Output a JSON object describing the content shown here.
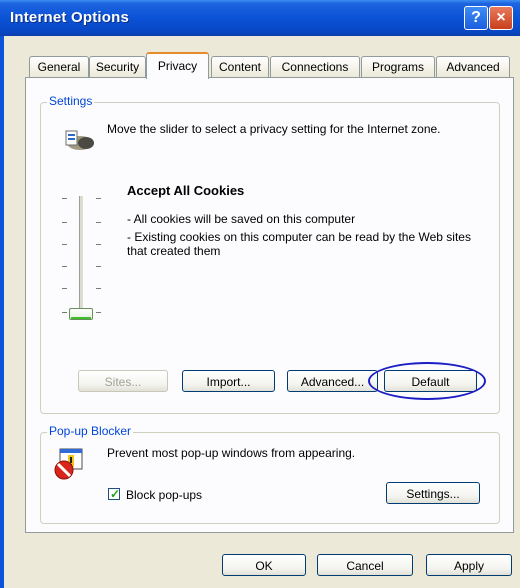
{
  "window": {
    "title": "Internet Options",
    "help_glyph": "?",
    "close_glyph": "×"
  },
  "tabs": [
    {
      "label": "General"
    },
    {
      "label": "Security"
    },
    {
      "label": "Privacy"
    },
    {
      "label": "Content"
    },
    {
      "label": "Connections"
    },
    {
      "label": "Programs"
    },
    {
      "label": "Advanced"
    }
  ],
  "active_tab": "Privacy",
  "settings": {
    "group_label": "Settings",
    "intro": "Move the slider to select a privacy setting for the Internet zone.",
    "level_title": "Accept All Cookies",
    "desc_line1": "- All cookies will be saved on this computer",
    "desc_line2": "- Existing cookies on this computer can be read by the Web sites that created them",
    "slider_level": 0,
    "buttons": {
      "sites": "Sites...",
      "import": "Import...",
      "advanced": "Advanced...",
      "default": "Default"
    }
  },
  "popup": {
    "group_label": "Pop-up Blocker",
    "text": "Prevent most pop-up windows from appearing.",
    "checkbox_label": "Block pop-ups",
    "checked": true,
    "settings_button": "Settings..."
  },
  "footer": {
    "ok": "OK",
    "cancel": "Cancel",
    "apply": "Apply"
  },
  "colors": {
    "title_bar": "#0b52d6",
    "group_label": "#0046d5",
    "highlight_ring": "#1d1fc4"
  },
  "icons": [
    "privacy-icon",
    "popup-blocker-icon",
    "help-icon",
    "close-icon"
  ]
}
